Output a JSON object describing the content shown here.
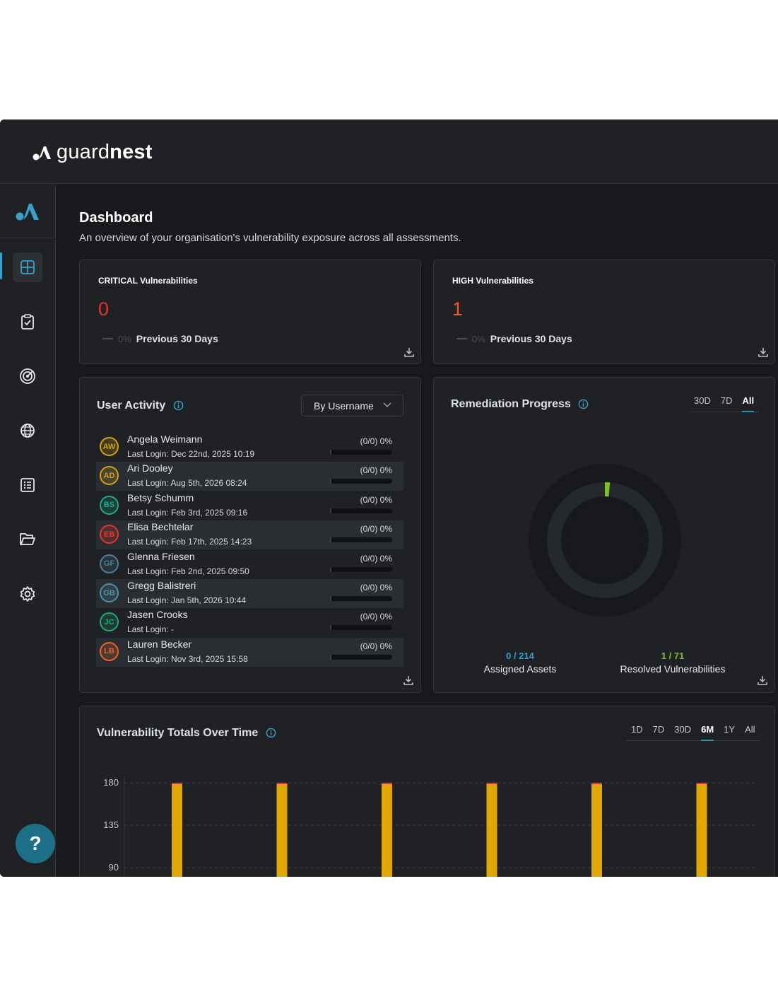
{
  "brand": {
    "name_light": "guard",
    "name_bold": "nest"
  },
  "colors": {
    "accent": "#2e8fb0",
    "critical": "#e5322d",
    "high": "#e85d2a",
    "bar_fill": "#e0a800",
    "assigned": "#2e9fd6",
    "resolved": "#7fbf2a"
  },
  "sidebar": {
    "items": [
      {
        "icon": "dashboard-grid-icon",
        "active": true
      },
      {
        "icon": "clipboard-check-icon",
        "active": false
      },
      {
        "icon": "target-icon",
        "active": false
      },
      {
        "icon": "globe-icon",
        "active": false
      },
      {
        "icon": "list-icon",
        "active": false
      },
      {
        "icon": "folder-icon",
        "active": false
      },
      {
        "icon": "gear-icon",
        "active": false
      }
    ],
    "help_label": "?"
  },
  "page": {
    "title": "Dashboard",
    "subtitle": "An overview of your organisation's vulnerability exposure across all assessments."
  },
  "critical": {
    "label": "CRITICAL Vulnerabilities",
    "value": "0",
    "change": "0%",
    "period": "Previous 30 Days"
  },
  "high": {
    "label": "HIGH Vulnerabilities",
    "value": "1",
    "change": "0%",
    "period": "Previous 30 Days"
  },
  "user_activity": {
    "title": "User Activity",
    "sort_label": "By Username",
    "users": [
      {
        "initials": "AW",
        "name": "Angela Weimann",
        "login": "Last Login: Dec 22nd, 2025 10:19",
        "stat": "(0/0) 0%",
        "color": "#d4a017",
        "progress": 0
      },
      {
        "initials": "AD",
        "name": "Ari Dooley",
        "login": "Last Login: Aug 5th, 2026 08:24",
        "stat": "(0/0) 0%",
        "color": "#d4a017",
        "progress": 0
      },
      {
        "initials": "BS",
        "name": "Betsy Schumm",
        "login": "Last Login: Feb 3rd, 2025 09:16",
        "stat": "(0/0) 0%",
        "color": "#1fa88a",
        "progress": 0
      },
      {
        "initials": "EB",
        "name": "Elisa Bechtelar",
        "login": "Last Login: Feb 17th, 2025 14:23",
        "stat": "(0/0) 0%",
        "color": "#e0352f",
        "progress": 0
      },
      {
        "initials": "GF",
        "name": "Glenna Friesen",
        "login": "Last Login: Feb 2nd, 2025 09:50",
        "stat": "(0/0) 0%",
        "color": "#4f7e96",
        "progress": 0
      },
      {
        "initials": "GB",
        "name": "Gregg Balistreri",
        "login": "Last Login: Jan 5th, 2026 10:44",
        "stat": "(0/0) 0%",
        "color": "#4f8fa8",
        "progress": 0
      },
      {
        "initials": "JC",
        "name": "Jasen Crooks",
        "login": "Last Login: -",
        "stat": "(0/0) 0%",
        "color": "#1fa87a",
        "progress": 0
      },
      {
        "initials": "LB",
        "name": "Lauren Becker",
        "login": "Last Login: Nov 3rd, 2025 15:58",
        "stat": "(0/0) 0%",
        "color": "#e8642a",
        "progress": 0
      }
    ]
  },
  "remediation": {
    "title": "Remediation Progress",
    "tabs": [
      "30D",
      "7D",
      "All"
    ],
    "selected_tab": "All",
    "assigned": {
      "value": "0 / 214",
      "label": "Assigned Assets",
      "fraction": 0
    },
    "resolved": {
      "value": "1 / 71",
      "label": "Resolved Vulnerabilities",
      "fraction": 0.014
    }
  },
  "totals": {
    "title": "Vulnerability Totals Over Time",
    "tabs": [
      "1D",
      "7D",
      "30D",
      "6M",
      "1Y",
      "All"
    ],
    "selected_tab": "6M"
  },
  "chart_data": {
    "type": "bar",
    "title": "Vulnerability Totals Over Time",
    "y_ticks": [
      "180",
      "135",
      "90"
    ],
    "ylim": [
      90,
      180
    ],
    "grid": true,
    "series": [
      {
        "values": [
          180,
          180,
          180,
          180,
          180,
          180
        ]
      }
    ]
  }
}
